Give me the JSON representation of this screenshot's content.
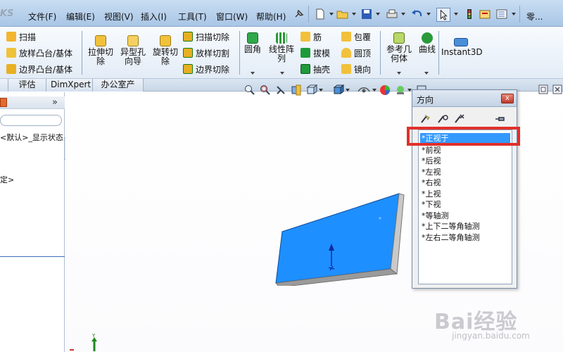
{
  "menubar": {
    "brand": "KS",
    "items": [
      "文件(F)",
      "编辑(E)",
      "视图(V)",
      "插入(I)",
      "工具(T)",
      "窗口(W)",
      "帮助(H)"
    ],
    "more": "零..."
  },
  "ribbon": {
    "small_left": [
      "扫描",
      "放样凸台/基体",
      "边界凸台/基体"
    ],
    "big": [
      "拉伸切\n除",
      "异型孔\n向导",
      "旋转切\n除"
    ],
    "cut_group": [
      "扫描切除",
      "放样切割",
      "边界切除"
    ],
    "fillet": "圆角",
    "linear_pattern": "线性阵\n列",
    "features_a": [
      "筋",
      "拔模",
      "抽壳"
    ],
    "features_b": [
      "包覆",
      "圆顶",
      "镜向"
    ],
    "reference_geometry": "参考几\n何体",
    "curves": "曲线",
    "instant3d": "Instant3D"
  },
  "tabs": [
    "评估",
    "DimXpert",
    "办公室产品"
  ],
  "left_panel": {
    "expand": "»",
    "tree_line_1": "<默认>_显示状态",
    "tree_line_2": "定>"
  },
  "orientation_dialog": {
    "title": "方向",
    "close": "x",
    "views": [
      "*正视于",
      "*前视",
      "*后视",
      "*左视",
      "*右视",
      "*上视",
      "*下视",
      "*等轴测",
      "*上下二等角轴测",
      "*左右二等角轴测"
    ],
    "selected_index": 0
  },
  "triad": {
    "y_label": "Y"
  },
  "watermark": {
    "logo": "Bai经验",
    "url": "jingyan.baidu.com"
  },
  "colors": {
    "part_face": "#1e8fff",
    "selection": "#3399ff",
    "highlight": "#e0302a"
  }
}
